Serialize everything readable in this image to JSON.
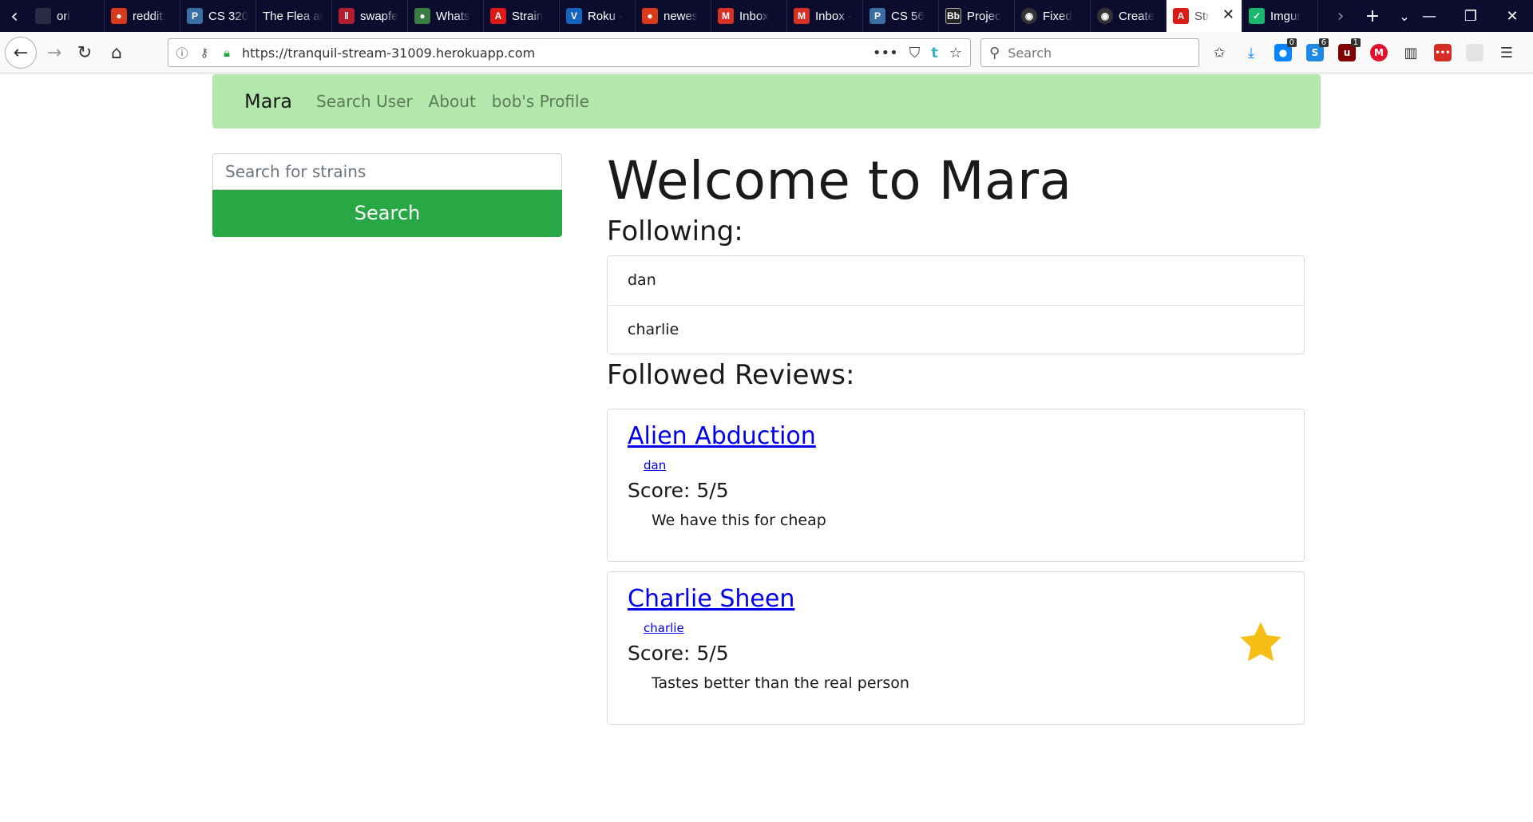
{
  "browser": {
    "tabs": [
      {
        "label": "ori",
        "icon": "reddit-alien-icon",
        "color": "#2b2b45"
      },
      {
        "label": "reddit:",
        "icon": "reddit-alien-icon",
        "color": "#d93a1b"
      },
      {
        "label": "CS 320",
        "icon": "piazza-icon",
        "color": "#3a6ea5"
      },
      {
        "label": "The Flea at",
        "icon": "",
        "color": ""
      },
      {
        "label": "swapfe",
        "icon": "swapfest-icon",
        "color": "#b01e2f"
      },
      {
        "label": "Whats",
        "icon": "reddit-alien-icon",
        "color": "#3a7d44"
      },
      {
        "label": "Strain",
        "icon": "angular-icon",
        "color": "#dd1b16"
      },
      {
        "label": "Roku -",
        "icon": "roku-v-icon",
        "color": "#1565c0"
      },
      {
        "label": "newes",
        "icon": "reddit-alien-icon",
        "color": "#d93a1b"
      },
      {
        "label": "Inbox",
        "icon": "gmail-icon",
        "color": "#d93025"
      },
      {
        "label": "Inbox -",
        "icon": "gmail-icon",
        "color": "#d93025"
      },
      {
        "label": "CS 56",
        "icon": "piazza-icon",
        "color": "#3a6ea5"
      },
      {
        "label": "Projec",
        "icon": "blackboard-icon",
        "color": "#222222"
      },
      {
        "label": "Fixed",
        "icon": "github-icon",
        "color": "#333333"
      },
      {
        "label": "Create",
        "icon": "github-icon",
        "color": "#333333"
      },
      {
        "label": "Str",
        "icon": "angular-icon",
        "color": "#dd1b16",
        "active": true
      },
      {
        "label": "Imgur",
        "icon": "imgur-icon",
        "color": "#1bb76e"
      }
    ],
    "url": "https://tranquil-stream-31009.herokuapp.com",
    "search_placeholder": "Search",
    "ext_badges": {
      "b1": "0",
      "b2": "6",
      "b3": "1"
    }
  },
  "site": {
    "brand": "Mara",
    "nav": [
      "Search User",
      "About",
      "bob's Profile"
    ],
    "strain_placeholder": "Search for strains",
    "search_button": "Search",
    "welcome": "Welcome to Mara",
    "following_heading": "Following:",
    "following": [
      "dan",
      "charlie"
    ],
    "reviews_heading": "Followed Reviews:",
    "reviews": [
      {
        "title": "Alien Abduction",
        "user": "dan",
        "score": "Score: 5/5",
        "text": "We have this for cheap",
        "starred": false
      },
      {
        "title": "Charlie Sheen",
        "user": "charlie",
        "score": "Score: 5/5",
        "text": "Tastes better than the real person",
        "starred": true
      }
    ],
    "star_color": "#f7be16"
  }
}
